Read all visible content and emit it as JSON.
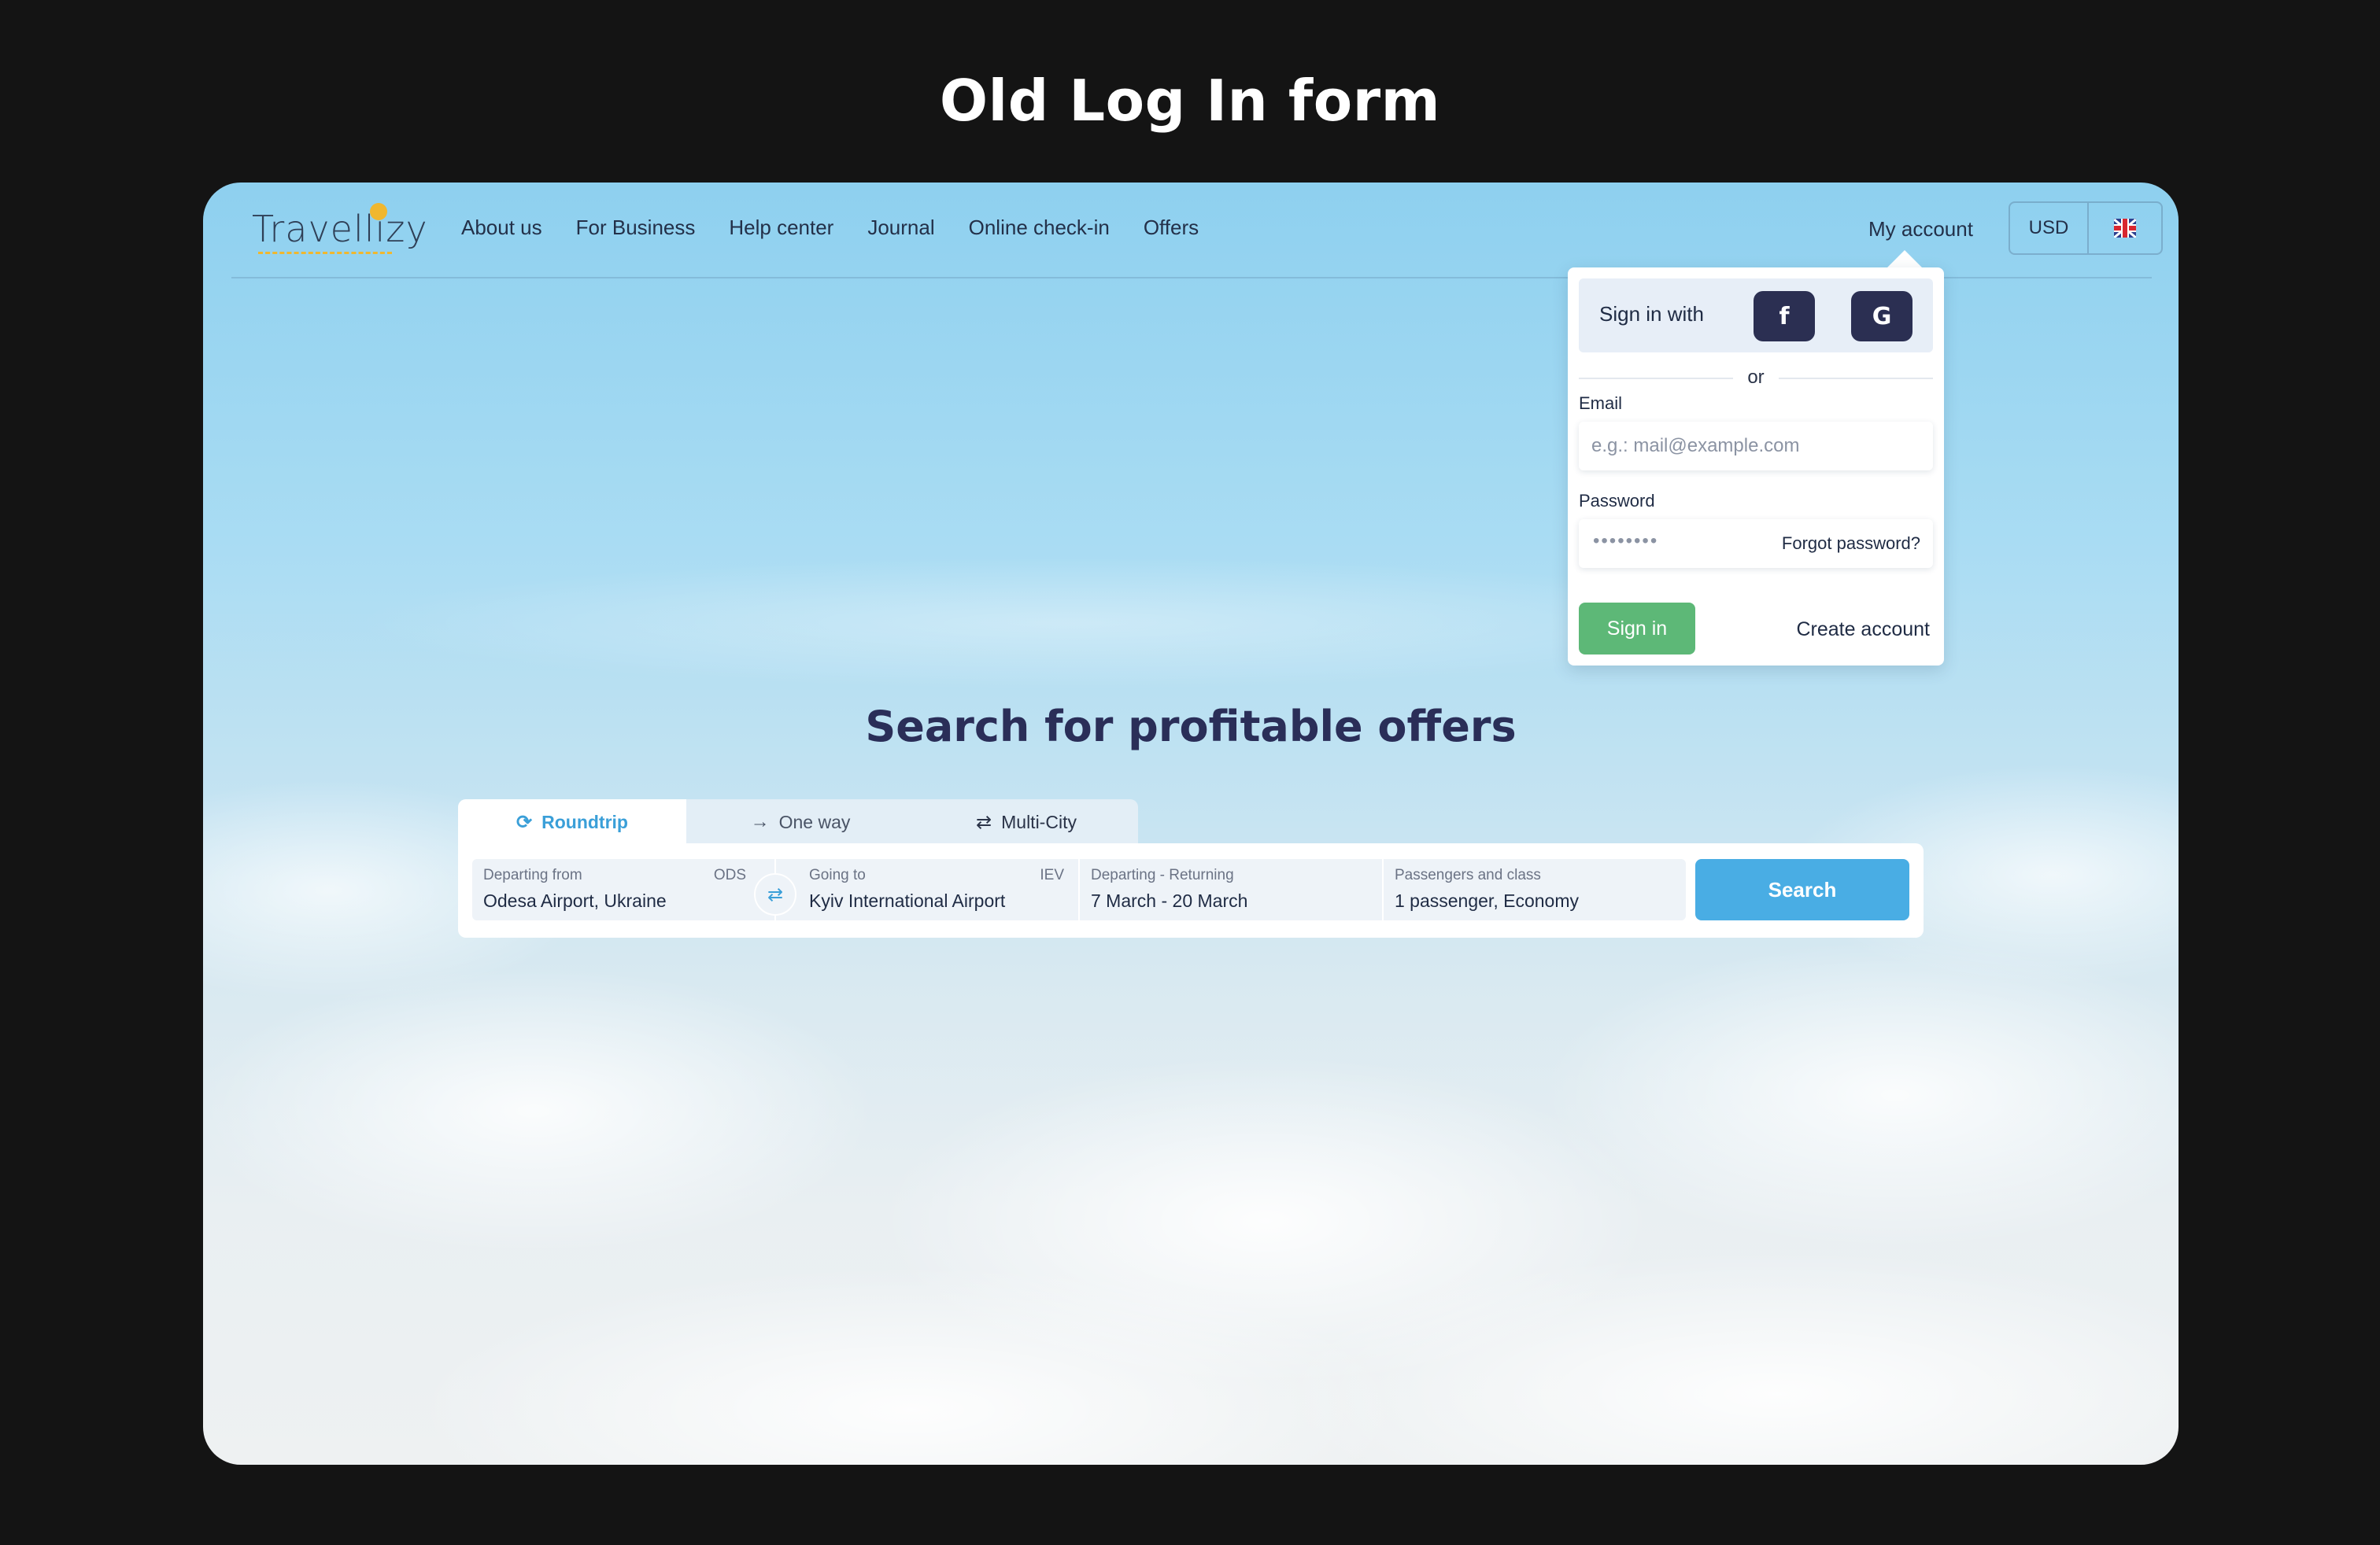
{
  "page": {
    "heading": "Old Log In form"
  },
  "navbar": {
    "logo_text": "Travellizy",
    "links": [
      "About us",
      "For Business",
      "Help center",
      "Journal",
      "Online check-in",
      "Offers"
    ],
    "my_account": "My account",
    "currency": "USD",
    "language_icon": "uk-flag-icon"
  },
  "login": {
    "sign_in_with": "Sign in with",
    "facebook_icon": "f",
    "google_icon": "G",
    "or": "or",
    "email_label": "Email",
    "email_placeholder": "e.g.: mail@example.com",
    "password_label": "Password",
    "password_value": "••••••••",
    "forgot_password": "Forgot password?",
    "sign_in_button": "Sign in",
    "create_account": "Create account"
  },
  "hero": {
    "title": "Search for profitable offers"
  },
  "search": {
    "tabs": [
      "Roundtrip",
      "One way",
      "Multi-City"
    ],
    "departing_label": "Departing from",
    "departing_code": "ODS",
    "departing_value": "Odesa Airport, Ukraine",
    "going_label": "Going to",
    "going_code": "IEV",
    "going_value": "Kyiv International Airport",
    "dates_label": "Departing - Returning",
    "dates_value": "7 March - 20 March",
    "passengers_label": "Passengers and class",
    "passengers_value": "1 passenger, Economy",
    "search_button": "Search"
  },
  "colors": {
    "background": "#141414",
    "accent_blue": "#49ade4",
    "sign_in_green": "#5db877",
    "dark_navy": "#2a2e58"
  }
}
